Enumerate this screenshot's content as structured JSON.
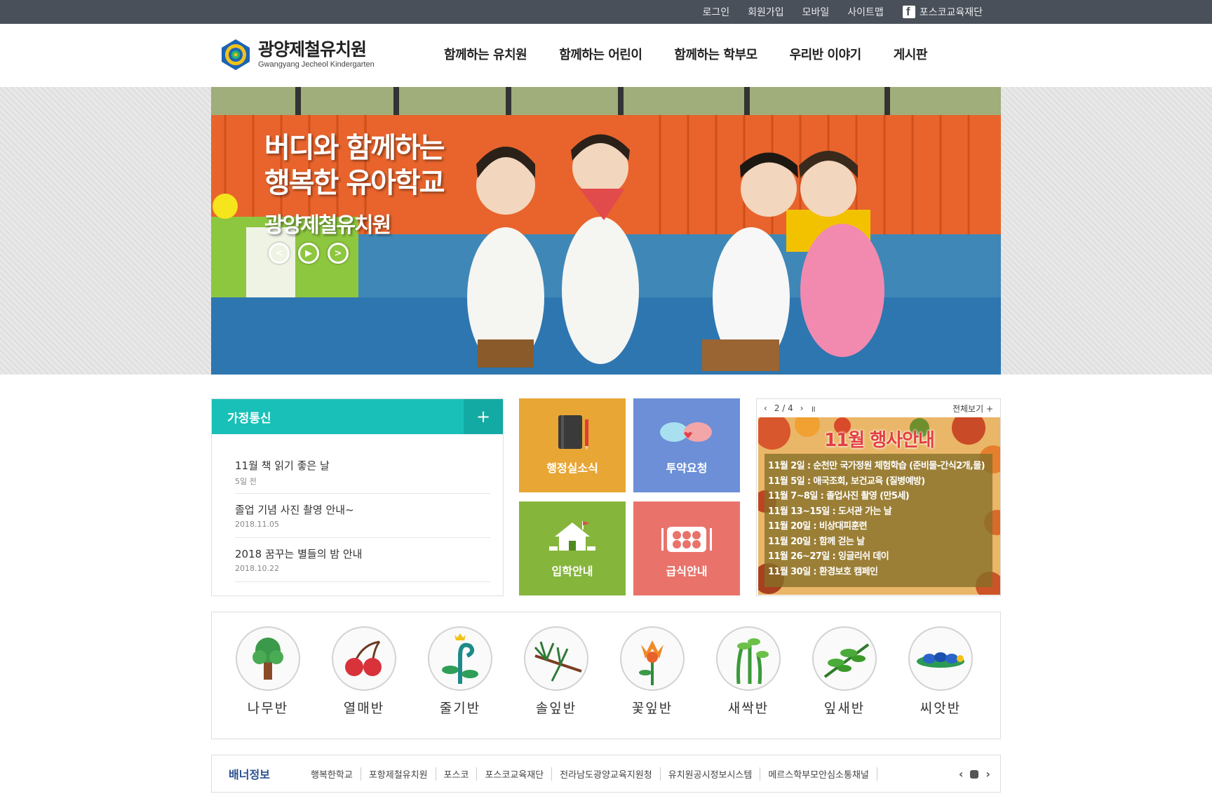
{
  "topbar": {
    "login": "로그인",
    "signup": "회원가입",
    "mobile": "모바일",
    "sitemap": "사이트맵",
    "foundation": "포스코교육재단"
  },
  "header": {
    "logo_kr": "광양제철유치원",
    "logo_en": "Gwangyang Jecheol Kindergarten",
    "nav": [
      "함께하는 유치원",
      "함께하는 어린이",
      "함께하는 학부모",
      "우리반 이야기",
      "게시판"
    ]
  },
  "hero": {
    "line1": "버디와 함께하는",
    "line2": "행복한 유아학교",
    "line3": "광양제철유치원",
    "prev_icon": "chevron-left-icon",
    "play_icon": "play-icon",
    "next_icon": "chevron-right-icon"
  },
  "notice": {
    "title": "가정통신",
    "more": "+",
    "items": [
      {
        "title": "11월 책 읽기 좋은 날",
        "date": "5일 전"
      },
      {
        "title": "졸업 기념 사진 촬영 안내~",
        "date": "2018.11.05"
      },
      {
        "title": "2018 꿈꾸는 별들의 밤 안내",
        "date": "2018.10.22"
      }
    ]
  },
  "tiles": {
    "admin_news": "행정실소식",
    "medicine": "투약요청",
    "admission": "입학안내",
    "meal": "급식안내",
    "colors": {
      "admin_news": "#e8a634",
      "medicine": "#6c8fd8",
      "admission": "#86b53c",
      "meal": "#e9736b"
    }
  },
  "event": {
    "prev": "‹",
    "page": "2 / 4",
    "next": "›",
    "pause": "॥",
    "view_all": "전체보기 +",
    "title": "11월 행사안내",
    "items": [
      "11월 2일 : 순천만 국가정원 체험학습 (준비물-간식2개,물)",
      "11월 5일 : 애국조회, 보건교육 (질병예방)",
      "11월 7~8일 : 졸업사진 촬영 (만5세)",
      "11월 13~15일 : 도서관 가는 날",
      "11월 20일 : 비상대피훈련",
      "11월 20일 : 함께 걷는 날",
      "11월 26~27일 : 잉글리쉬 데이",
      "11월 30일 : 환경보호 캠페인"
    ]
  },
  "classes": [
    {
      "name": "나무반",
      "icon": "tree-icon"
    },
    {
      "name": "열매반",
      "icon": "cherry-icon"
    },
    {
      "name": "줄기반",
      "icon": "stem-icon"
    },
    {
      "name": "솔잎반",
      "icon": "pine-icon"
    },
    {
      "name": "꽃잎반",
      "icon": "flower-icon"
    },
    {
      "name": "새싹반",
      "icon": "sprout-icon"
    },
    {
      "name": "잎새반",
      "icon": "leaf-icon"
    },
    {
      "name": "씨앗반",
      "icon": "seed-icon"
    }
  ],
  "banner": {
    "title": "배너정보",
    "items": [
      "행복한학교",
      "포항제철유치원",
      "포스코",
      "포스코교육재단",
      "전라남도광양교육지원청",
      "유치원공시정보시스템",
      "메르스학부모안심소통채널"
    ],
    "prev": "‹",
    "next": "›"
  }
}
